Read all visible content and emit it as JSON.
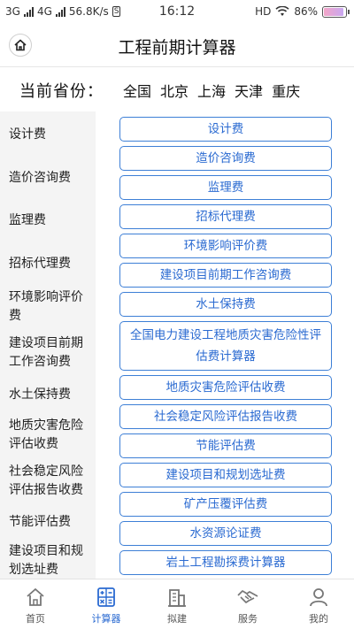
{
  "status": {
    "net1": "3G",
    "net2": "4G",
    "speed": "56.8K/s",
    "speed_badge": "S",
    "time": "16:12",
    "hd": "HD",
    "battery": "86%"
  },
  "header": {
    "title": "工程前期计算器"
  },
  "province": {
    "label": "当前省份：",
    "options": [
      "全国",
      "北京",
      "上海",
      "天津",
      "重庆"
    ]
  },
  "sidebar": {
    "items": [
      "设计费",
      "造价咨询费",
      "监理费",
      "招标代理费",
      "环境影响评价费",
      "建设项目前期工作咨询费",
      "水土保持费",
      "地质灾害危险评估收费",
      "社会稳定风险评估报告收费",
      "节能评估费",
      "建设项目和规划选址费"
    ]
  },
  "main": {
    "buttons": [
      "设计费",
      "造价咨询费",
      "监理费",
      "招标代理费",
      "环境影响评价费",
      "建设项目前期工作咨询费",
      "水土保持费",
      "全国电力建设工程地质灾害危险性评估费计算器",
      "地质灾害危险评估收费",
      "社会稳定风险评估报告收费",
      "节能评估费",
      "建设项目和规划选址费",
      "矿产压覆评估费",
      "水资源论证费",
      "岩土工程勘探费计算器"
    ]
  },
  "nav": {
    "items": [
      {
        "label": "首页",
        "icon": "home-icon"
      },
      {
        "label": "计算器",
        "icon": "calculator-icon"
      },
      {
        "label": "拟建",
        "icon": "building-icon"
      },
      {
        "label": "服务",
        "icon": "handshake-icon"
      },
      {
        "label": "我的",
        "icon": "person-icon"
      }
    ],
    "active_index": 1
  },
  "colors": {
    "accent": "#2a6ad1",
    "button_border": "#3d7fd6",
    "sidebar_bg": "#f4f4f4"
  }
}
